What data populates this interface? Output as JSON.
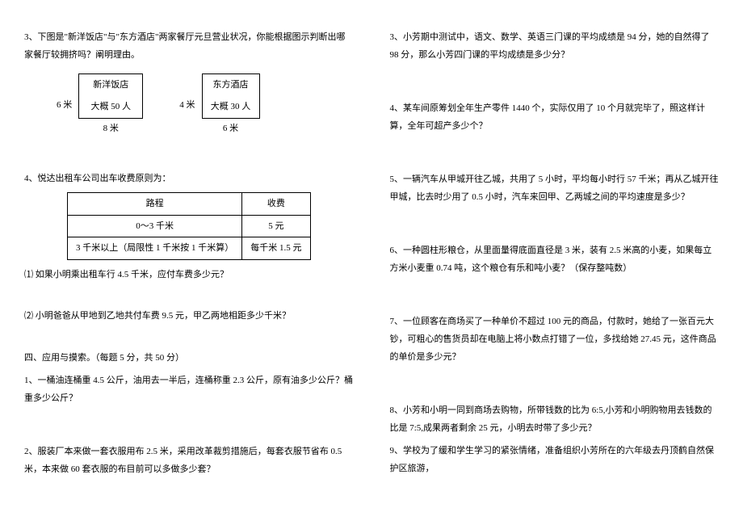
{
  "left": {
    "q3": {
      "text": "3、下图是\"新洋饭店\"与\"东方酒店\"两家餐厅元旦营业状况，你能根据图示判断出哪家餐厅较拥挤吗？阐明理由。",
      "rest1": {
        "height": "6 米",
        "name": "新洋饭店",
        "cap": "大概 50 人",
        "width": "8 米"
      },
      "rest2": {
        "height": "4 米",
        "name": "东方酒店",
        "cap": "大概 30 人",
        "width": "6 米"
      }
    },
    "q4": {
      "text": "4、悦达出租车公司出车收费原则为：",
      "table": {
        "h1": "路程",
        "h2": "收费",
        "r1c1": "0～3 千米",
        "r1c2": "5 元",
        "r2c1": "3 千米以上（局限性 1 千米按 1 千米算）",
        "r2c2": "每千米 1.5 元"
      },
      "sub1": "⑴ 如果小明乘出租车行 4.5 千米，应付车费多少元？",
      "sub2": "⑵ 小明爸爸从甲地到乙地共付车费 9.5 元，甲乙两地相距多少千米？"
    },
    "section4": {
      "title": "四、应用与摸索。（每题 5 分，共 50 分）",
      "q1": "1、一桶油连桶重 4.5 公斤，油用去一半后，连桶称重 2.3 公斤，原有油多少公斤？桶重多少公斤？",
      "q2": "2、服装厂本来做一套衣服用布 2.5 米，采用改革裁剪措施后，每套衣服节省布 0.5 米，本来做 60 套衣服的布目前可以多做多少套？"
    }
  },
  "right": {
    "q3": "3、小芳期中测试中，语文、数学、英语三门课的平均成绩是 94 分，她的自然得了 98 分，那么小芳四门课的平均成绩是多少分？",
    "q4": "4、某车间原筹划全年生产零件 1440 个，实际仅用了 10 个月就完毕了，照这样计算，全年可超产多少个？",
    "q5": "5、一辆汽车从甲城开往乙城，共用了 5 小时，平均每小时行 57 千米；再从乙城开往甲城，比去时少用了 0.5 小时，汽车来回甲、乙两城之间的平均速度是多少？",
    "q6": "6、一种圆柱形粮仓，从里面量得底面直径是 3 米，装有 2.5 米高的小麦，如果每立方米小麦重 0.74 吨，这个粮仓有乐和吨小麦？（保存整吨数）",
    "q7": "7、一位顾客在商场买了一种单价不超过 100 元的商品，付款时，她给了一张百元大钞，可粗心的售货员却在电脑上将小数点打错了一位，多找给她 27.45 元，这件商品的单价是多少元？",
    "q8": "8、小芳和小明一同到商场去购物，所带钱数的比为 6:5,小芳和小明购物用去钱数的比是 7:5,成果两者剩余 25 元，小明去时带了多少元？",
    "q9": "9、学校为了缓和学生学习的紧张情绪，准备组织小芳所在的六年级去丹顶鹤自然保护区旅游，"
  }
}
